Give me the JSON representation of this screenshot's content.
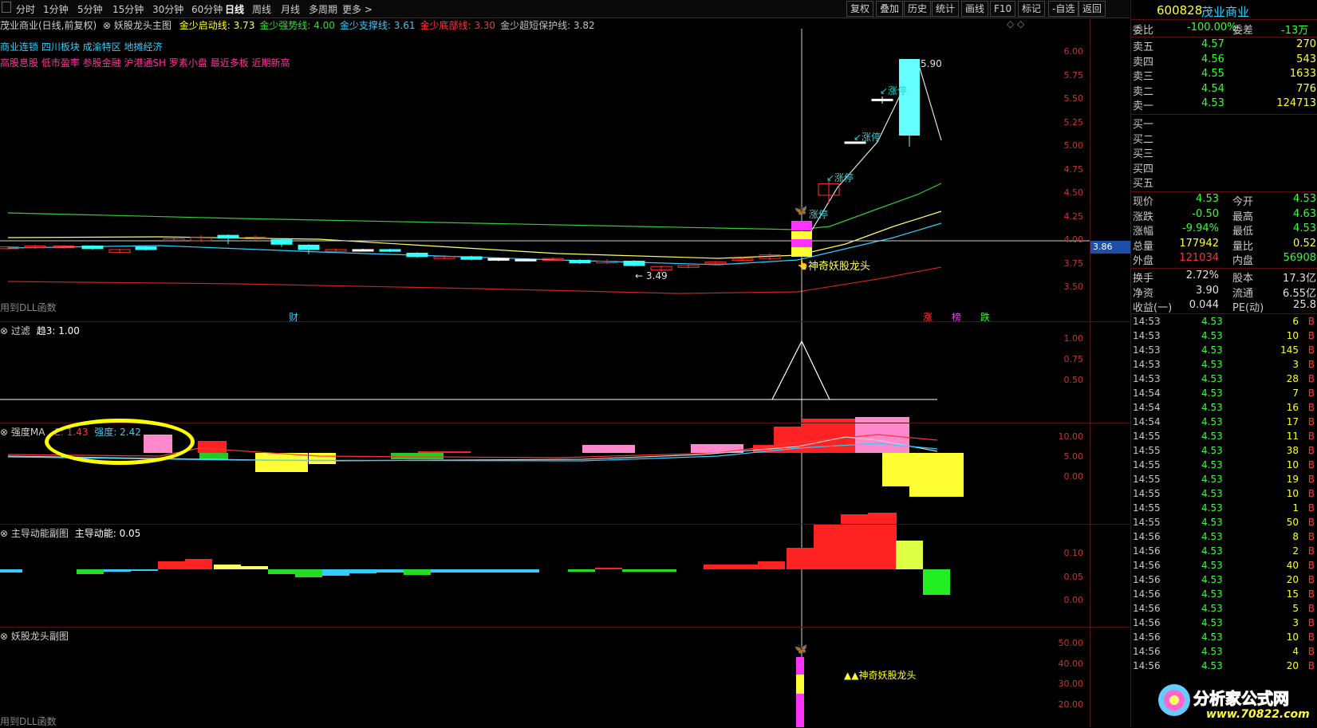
{
  "toolbar": {
    "periods": [
      "分时",
      "1分钟",
      "5分钟",
      "15分钟",
      "30分钟",
      "60分钟",
      "日线",
      "周线",
      "月线",
      "多周期",
      "更多 >"
    ],
    "active_period": "日线",
    "right_buttons": [
      "复权",
      "叠加",
      "历史",
      "统计",
      "画线",
      "F10",
      "标记",
      "-自选",
      "返回"
    ]
  },
  "main_panel": {
    "stock_line": "茂业商业(日线,前复权)",
    "indicator_name": "妖股龙头主图",
    "indicators": [
      {
        "label": "金少启动线: 3.73",
        "color": "#ffff33"
      },
      {
        "label": "金少强势线: 4.00",
        "color": "#33dd33"
      },
      {
        "label": "金少支撑线: 3.61",
        "color": "#33ccff"
      },
      {
        "label": "金少底部线: 3.30",
        "color": "#ff3333"
      },
      {
        "label": "金少超短保护线: 3.82",
        "color": "#c0c0c0"
      }
    ],
    "concepts_line1": "商业连锁 四川板块 成渝特区 地摊经济",
    "concepts_line2": "高股息股 低市盈率 参股金融 沪港通SH 罗素小盘 最近多板 近期新高",
    "y_labels": [
      "6.00",
      "5.75",
      "5.50",
      "5.25",
      "5.00",
      "4.75",
      "4.50",
      "4.25",
      "4.00",
      "3.75",
      "3.50"
    ],
    "current_price_tag": "3.86",
    "high_label": "5.90",
    "low_label": "← 3.49",
    "limit_up_labels": [
      "↙涨停",
      "↙涨停",
      "↙涨停",
      "涨停"
    ],
    "signal_label": "神奇妖股龙头",
    "dll_note": "用到DLL函数",
    "bottom_marks": {
      "cai": "财",
      "zhang": "涨",
      "bang": "榜",
      "die": "跌"
    }
  },
  "filter_panel": {
    "title": "过滤",
    "value": "趋3: 1.00",
    "y_labels": [
      "1.00",
      "0.75",
      "0.50"
    ]
  },
  "strength_panel": {
    "title": "强度MA",
    "e_value": "E: 1.43",
    "strength_value": "强度: 2.42",
    "y_labels": [
      "10.00",
      "5.00",
      "0.00"
    ]
  },
  "power_panel": {
    "title": "主导动能副图",
    "value": "主导动能: 0.05",
    "y_labels": [
      "0.10",
      "0.05",
      "0.00"
    ]
  },
  "yao_panel": {
    "title": "妖股龙头副图",
    "signal_label": "▲▲神奇妖股龙头",
    "y_labels": [
      "50.00",
      "40.00",
      "30.00",
      "20.00"
    ],
    "dll_note": "用到DLL函数"
  },
  "quote": {
    "code": "600828",
    "name": "茂业商业",
    "weibi_label": "委比",
    "weibi": "-100.00%",
    "weicha_label": "委差",
    "weicha": "-13万",
    "asks": [
      {
        "label": "卖五",
        "price": "4.57",
        "vol": "270"
      },
      {
        "label": "卖四",
        "price": "4.56",
        "vol": "543"
      },
      {
        "label": "卖三",
        "price": "4.55",
        "vol": "1633"
      },
      {
        "label": "卖二",
        "price": "4.54",
        "vol": "776"
      },
      {
        "label": "卖一",
        "price": "4.53",
        "vol": "124713"
      }
    ],
    "bids": [
      "买一",
      "买二",
      "买三",
      "买四",
      "买五"
    ],
    "stats": [
      {
        "l1": "现价",
        "v1": "4.53",
        "l2": "今开",
        "v2": "4.53"
      },
      {
        "l1": "涨跌",
        "v1": "-0.50",
        "l2": "最高",
        "v2": "4.63"
      },
      {
        "l1": "涨幅",
        "v1": "-9.94%",
        "l2": "最低",
        "v2": "4.53"
      },
      {
        "l1": "总量",
        "v1": "177942",
        "l2": "量比",
        "v2": "0.52"
      },
      {
        "l1": "外盘",
        "v1": "121034",
        "l2": "内盘",
        "v2": "56908"
      }
    ],
    "fund": [
      {
        "l1": "换手",
        "v1": "2.72%",
        "l2": "股本",
        "v2": "17.3亿"
      },
      {
        "l1": "净资",
        "v1": "3.90",
        "l2": "流通",
        "v2": "6.55亿"
      },
      {
        "l1": "收益(一)",
        "v1": "0.044",
        "l2": "PE(动)",
        "v2": "25.8"
      }
    ],
    "ticks": [
      {
        "t": "14:53",
        "p": "4.53",
        "v": "6",
        "d": "B"
      },
      {
        "t": "14:53",
        "p": "4.53",
        "v": "10",
        "d": "B"
      },
      {
        "t": "14:53",
        "p": "4.53",
        "v": "145",
        "d": "B"
      },
      {
        "t": "14:53",
        "p": "4.53",
        "v": "3",
        "d": "B"
      },
      {
        "t": "14:53",
        "p": "4.53",
        "v": "28",
        "d": "B"
      },
      {
        "t": "14:54",
        "p": "4.53",
        "v": "7",
        "d": "B"
      },
      {
        "t": "14:54",
        "p": "4.53",
        "v": "16",
        "d": "B"
      },
      {
        "t": "14:54",
        "p": "4.53",
        "v": "17",
        "d": "B"
      },
      {
        "t": "14:55",
        "p": "4.53",
        "v": "11",
        "d": "B"
      },
      {
        "t": "14:55",
        "p": "4.53",
        "v": "38",
        "d": "B"
      },
      {
        "t": "14:55",
        "p": "4.53",
        "v": "10",
        "d": "B"
      },
      {
        "t": "14:55",
        "p": "4.53",
        "v": "19",
        "d": "B"
      },
      {
        "t": "14:55",
        "p": "4.53",
        "v": "10",
        "d": "B"
      },
      {
        "t": "14:55",
        "p": "4.53",
        "v": "1",
        "d": "B"
      },
      {
        "t": "14:55",
        "p": "4.53",
        "v": "50",
        "d": "B"
      },
      {
        "t": "14:56",
        "p": "4.53",
        "v": "8",
        "d": "B"
      },
      {
        "t": "14:56",
        "p": "4.53",
        "v": "2",
        "d": "B"
      },
      {
        "t": "14:56",
        "p": "4.53",
        "v": "40",
        "d": "B"
      },
      {
        "t": "14:56",
        "p": "4.53",
        "v": "20",
        "d": "B"
      },
      {
        "t": "14:56",
        "p": "4.53",
        "v": "15",
        "d": "B"
      },
      {
        "t": "14:56",
        "p": "4.53",
        "v": "5",
        "d": "B"
      },
      {
        "t": "14:56",
        "p": "4.53",
        "v": "3",
        "d": "B"
      },
      {
        "t": "14:56",
        "p": "4.53",
        "v": "10",
        "d": "B"
      },
      {
        "t": "14:56",
        "p": "4.53",
        "v": "4",
        "d": "B"
      },
      {
        "t": "14:56",
        "p": "4.53",
        "v": "20",
        "d": "B"
      }
    ]
  },
  "watermark": {
    "brand": "分析家公式网",
    "url": "www.70822.com"
  },
  "colors": {
    "up": "#ff3333",
    "down": "#33ffff",
    "yellow": "#ffff33",
    "green": "#33dd33",
    "magenta": "#ff33ff"
  }
}
